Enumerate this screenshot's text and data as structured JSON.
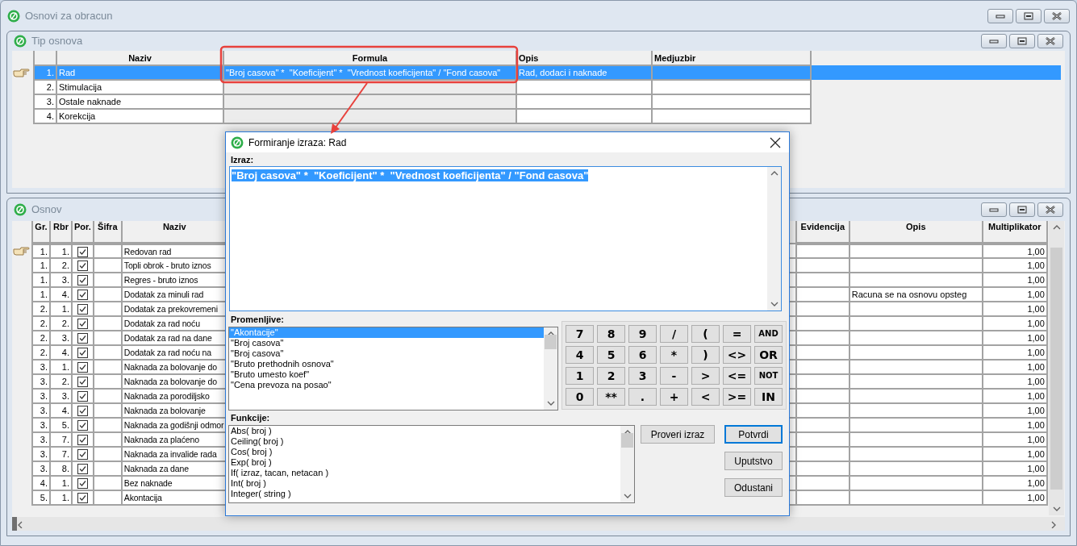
{
  "main_window": {
    "title": "Osnovi za obracun"
  },
  "tip_osnova": {
    "title": "Tip osnova",
    "columns": [
      "Naziv",
      "Formula",
      "Opis",
      "Medjuzbir"
    ],
    "rows": [
      {
        "num": "1.",
        "naziv": "Rad",
        "formula": "\"Broj casova\" *  \"Koeficijent\" *  \"Vrednost koeficijenta\" / \"Fond casova\"",
        "opis": "Rad, dodaci i naknade",
        "selected": true
      },
      {
        "num": "2.",
        "naziv": "Stimulacija",
        "selected": false
      },
      {
        "num": "3.",
        "naziv": "Ostale naknade",
        "selected": false
      },
      {
        "num": "4.",
        "naziv": "Korekcija",
        "selected": false
      }
    ]
  },
  "osnov": {
    "title": "Osnov",
    "columns": [
      "Gr.",
      "Rbr",
      "Por.",
      "Šifra",
      "Naziv",
      "Evidencija",
      "Opis",
      "Multiplikator"
    ],
    "rows": [
      {
        "gr": "1.",
        "rbr": "1.",
        "por": true,
        "naziv": "Redovan rad",
        "multiplikator": "1,00",
        "current": true
      },
      {
        "gr": "1.",
        "rbr": "2.",
        "por": true,
        "naziv": "Topli obrok - bruto iznos",
        "multiplikator": "1,00",
        "current": false
      },
      {
        "gr": "1.",
        "rbr": "3.",
        "por": true,
        "naziv": "Regres - bruto iznos",
        "multiplikator": "1,00",
        "current": false
      },
      {
        "gr": "1.",
        "rbr": "4.",
        "por": true,
        "naziv": "Dodatak za minuli rad",
        "opis": "Racuna se na osnovu opsteg",
        "multiplikator": "1,00",
        "current": false
      },
      {
        "gr": "2.",
        "rbr": "1.",
        "por": true,
        "naziv": "Dodatak za prekovremeni",
        "multiplikator": "1,00",
        "current": false
      },
      {
        "gr": "2.",
        "rbr": "2.",
        "por": true,
        "naziv": "Dodatak za rad noću",
        "multiplikator": "1,00",
        "current": false
      },
      {
        "gr": "2.",
        "rbr": "3.",
        "por": true,
        "naziv": "Dodatak za rad na dane",
        "multiplikator": "1,00",
        "current": false
      },
      {
        "gr": "2.",
        "rbr": "4.",
        "por": true,
        "naziv": "Dodatak za rad noću na",
        "multiplikator": "1,00",
        "current": false
      },
      {
        "gr": "3.",
        "rbr": "1.",
        "por": true,
        "naziv": "Naknada za bolovanje do",
        "multiplikator": "1,00",
        "current": false
      },
      {
        "gr": "3.",
        "rbr": "2.",
        "por": true,
        "naziv": "Naknada za bolovanje do",
        "multiplikator": "1,00",
        "current": false
      },
      {
        "gr": "3.",
        "rbr": "3.",
        "por": true,
        "naziv": "Naknada za porodiljsko",
        "multiplikator": "1,00",
        "current": false
      },
      {
        "gr": "3.",
        "rbr": "4.",
        "por": true,
        "naziv": "Naknada za bolovanje",
        "multiplikator": "1,00",
        "current": false
      },
      {
        "gr": "3.",
        "rbr": "5.",
        "por": true,
        "naziv": "Naknada za godišnji odmor",
        "multiplikator": "1,00",
        "current": false
      },
      {
        "gr": "3.",
        "rbr": "7.",
        "por": true,
        "naziv": "Naknada za plaćeno",
        "multiplikator": "1,00",
        "current": false
      },
      {
        "gr": "3.",
        "rbr": "7.",
        "por": true,
        "naziv": "Naknada za invalide rada",
        "multiplikator": "1,00",
        "current": false
      },
      {
        "gr": "3.",
        "rbr": "8.",
        "por": true,
        "naziv": "Naknada za dane",
        "multiplikator": "1,00",
        "current": false
      },
      {
        "gr": "4.",
        "rbr": "1.",
        "por": true,
        "naziv": "Bez naknade",
        "multiplikator": "1,00",
        "current": false
      },
      {
        "gr": "5.",
        "rbr": "1.",
        "por": true,
        "naziv": "Akontacija",
        "multiplikator": "1,00",
        "current": false
      }
    ]
  },
  "dialog": {
    "title": "Formiranje izraza: Rad",
    "izraz_label": "Izraz:",
    "expression": "\"Broj casova\" *  \"Koeficijent\" *  \"Vrednost koeficijenta\" / \"Fond casova\"",
    "expression_selected": true,
    "promenljive_label": "Promenljive:",
    "variables": [
      {
        "label": "\"Akontacije\"",
        "selected": true
      },
      {
        "label": "\"Broj casova\"",
        "selected": false
      },
      {
        "label": "\"Broj casova\"",
        "selected": false
      },
      {
        "label": "\"Bruto prethodnih osnova\"",
        "selected": false
      },
      {
        "label": "\"Bruto umesto koef\"",
        "selected": false
      },
      {
        "label": "\"Cena prevoza na posao\"",
        "selected": false
      }
    ],
    "keypad": [
      "7",
      "8",
      "9",
      "/",
      "(",
      "=",
      "AND",
      "4",
      "5",
      "6",
      "*",
      ")",
      "<>",
      "OR",
      "1",
      "2",
      "3",
      "-",
      ">",
      "<=",
      "NOT",
      "0",
      "**",
      ".",
      "+",
      "<",
      ">=",
      "IN"
    ],
    "funkcije_label": "Funkcije:",
    "functions": [
      "Abs( broj )",
      "Ceiling( broj )",
      "Cos( broj )",
      "Exp( broj )",
      "If( izraz, tacan, netacan )",
      "Int( broj )",
      "Integer( string )"
    ],
    "buttons": [
      {
        "label": "Proveri izraz",
        "default": false
      },
      {
        "label": "Potvrdi",
        "default": true
      },
      {
        "label": "Uputstvo",
        "default": false
      },
      {
        "label": "Odustani",
        "default": false
      }
    ]
  }
}
